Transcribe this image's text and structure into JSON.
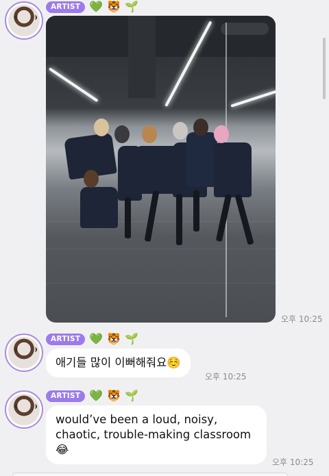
{
  "messages": [
    {
      "badge": "ARTIST",
      "emojis": [
        "💚",
        "🐯",
        "🌱"
      ],
      "type": "image",
      "time": "오후 10:25"
    },
    {
      "badge": "ARTIST",
      "emojis": [
        "💚",
        "🐯",
        "🌱"
      ],
      "type": "text",
      "text": "애기들 많이 이뻐해줘요☺️",
      "time": "오후 10:25"
    },
    {
      "badge": "ARTIST",
      "emojis": [
        "💚",
        "🐯",
        "🌱"
      ],
      "type": "text",
      "text": "would’ve been a loud, noisy, chaotic, trouble-making classroom 😂",
      "time": "오후 10:25"
    }
  ],
  "colors": {
    "background": "#f0f0f2",
    "badge": "#9b7be9",
    "avatar_ring": "#a88be0",
    "bubble": "#ffffff",
    "time": "#8a8a8e"
  }
}
